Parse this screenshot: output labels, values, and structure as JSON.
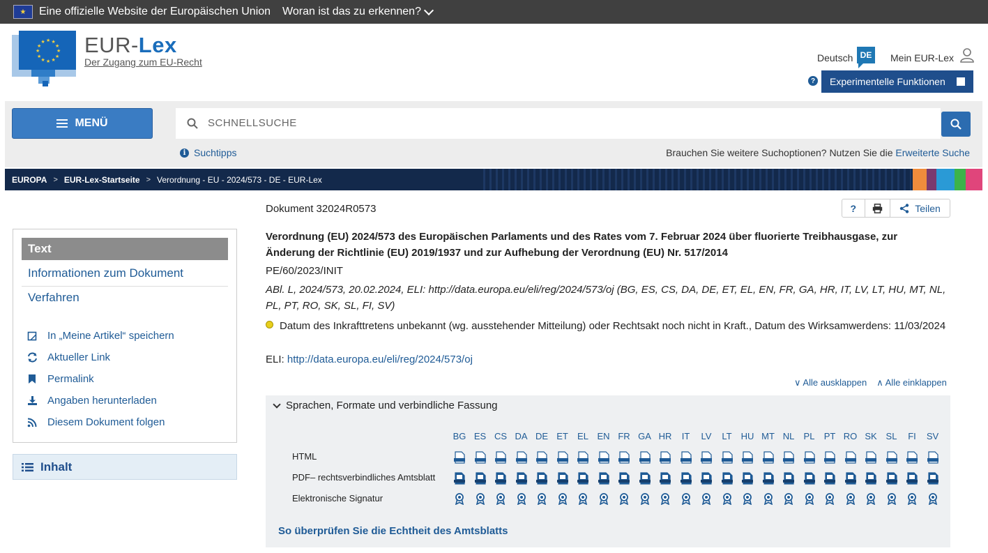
{
  "eu_bar": {
    "official_text": "Eine offizielle Website der Europäischen Union",
    "how_to_know": "Woran ist das zu erkennen?"
  },
  "header": {
    "site_name_part1": "EUR-",
    "site_name_part2": "Lex",
    "site_subtitle": "Der Zugang zum EU-Recht",
    "language_label": "Deutsch",
    "language_code": "DE",
    "my_eurlex": "Mein EUR-Lex",
    "experimental_help": "?",
    "experimental_label": "Experimentelle Funktionen"
  },
  "search": {
    "menu_label": "MENÜ",
    "placeholder": "SCHNELLSUCHE",
    "tips_label": "Suchtipps",
    "advanced_prompt": "Brauchen Sie weitere Suchoptionen? Nutzen Sie die",
    "advanced_link": "Erweiterte Suche"
  },
  "breadcrumb": {
    "items": [
      "EUROPA",
      "EUR-Lex-Startseite",
      "Verordnung - EU - 2024/573 - DE - EUR-Lex"
    ],
    "stripe_colors": [
      "#f08c3c",
      "#7a3a6e",
      "#2a9ad6",
      "#3cb34a",
      "#e0457b"
    ]
  },
  "sidebar": {
    "active_tab": "Text",
    "links": [
      "Informationen zum Dokument",
      "Verfahren"
    ],
    "tools": [
      "In „Meine Artikel“ speichern",
      "Aktueller Link",
      "Permalink",
      "Angaben herunterladen",
      "Diesem Dokument folgen"
    ],
    "tool_icons": [
      "bookmark-outline-icon",
      "refresh-icon",
      "bookmark-icon",
      "download-icon",
      "rss-icon"
    ],
    "inhalt_label": "Inhalt"
  },
  "document": {
    "id_label": "Dokument 32024R0573",
    "help": "?",
    "share_label": "Teilen",
    "title": "Verordnung (EU) 2024/573 des Europäischen Parlaments und des Rates vom 7. Februar 2024 über fluorierte Treibhausgase, zur Änderung der Richtlinie (EU) 2019/1937 und zur Aufhebung der Verordnung (EU) Nr. 517/2014",
    "reference": "PE/60/2023/INIT",
    "oj_reference": "ABl. L, 2024/573, 20.02.2024, ELI: http://data.europa.eu/eli/reg/2024/573/oj (BG, ES, CS, DA, DE, ET, EL, EN, FR, GA, HR, IT, LV, LT, HU, MT, NL, PL, PT, RO, SK, SL, FI, SV)",
    "status": "Datum des Inkrafttretens unbekannt (wg. ausstehender Mitteilung) oder Rechtsakt noch nicht in Kraft., Datum des Wirksamwerdens: 11/03/2024",
    "eli_label": "ELI:",
    "eli_link": "http://data.europa.eu/eli/reg/2024/573/oj",
    "expand_all": "Alle ausklappen",
    "collapse_all": "Alle einklappen"
  },
  "languages_panel": {
    "heading": "Sprachen, Formate und verbindliche Fassung",
    "languages": [
      "BG",
      "ES",
      "CS",
      "DA",
      "DE",
      "ET",
      "EL",
      "EN",
      "FR",
      "GA",
      "HR",
      "IT",
      "LV",
      "LT",
      "HU",
      "MT",
      "NL",
      "PL",
      "PT",
      "RO",
      "SK",
      "SL",
      "FI",
      "SV"
    ],
    "rows": [
      "HTML",
      "PDF– rechtsverbindliches Amtsblatt",
      "Elektronische Signatur"
    ],
    "verify_link": "So überprüfen Sie die Echtheit des Amtsblatts"
  }
}
